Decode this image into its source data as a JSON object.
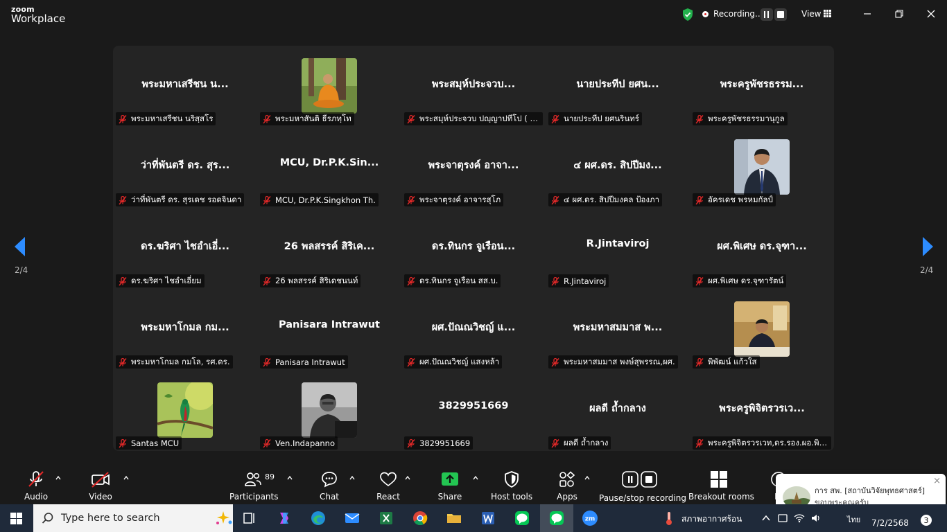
{
  "window": {
    "brand_top": "zoom",
    "brand_bottom": "Workplace",
    "recording_label": "Recording...",
    "view_label": "View"
  },
  "colors": {
    "accent_blue": "#2d8cff",
    "muted_red": "#e02828",
    "verified_green": "#23b14d",
    "share_green": "#23c552"
  },
  "gallery": {
    "page_left": "2/4",
    "page_right": "2/4",
    "tiles": [
      {
        "big": "พระมหาเสรีชน น...",
        "label": "พระมหาเสรีชน นริสฺสโร",
        "photo": ""
      },
      {
        "big": "",
        "label": "พระมหาสันติ ธีรภทฺโท",
        "photo": "monk-photo"
      },
      {
        "big": "พระสมุห์ประจวบ...",
        "label": "พระสมุห์ประจวบ  ปญฺญาปทีโป ( อย่...",
        "photo": ""
      },
      {
        "big": "นายประทีป  ยศน...",
        "label": "นายประทีป  ยศนรินทร์",
        "photo": ""
      },
      {
        "big": "พระครูพัชรธรรม...",
        "label": "พระครูพัชรธรรมานุกูล",
        "photo": ""
      },
      {
        "big": "ว่าที่พันตรี ดร. สุร...",
        "label": "ว่าที่พันตรี ดร. สุรเดช รอดจินดา",
        "photo": ""
      },
      {
        "big": "MCU,  Dr.P.K.Sin...",
        "label": "MCU, Dr.P.K.Singkhon Th.",
        "photo": ""
      },
      {
        "big": "พระจาตุรงค์ อาจา...",
        "label": "พระจาตุรงค์ อาจารสุโภ",
        "photo": ""
      },
      {
        "big": "๔ ผศ.ดร. สิปปีมง...",
        "label": "๔ ผศ.ดร. สิปปีมงคล ป้องภา",
        "photo": ""
      },
      {
        "big": "",
        "label": "อัครเดช พรหมกัลป์",
        "photo": "suit-photo"
      },
      {
        "big": "ดร.ฆริศา ไชอำเอี่...",
        "label": "ดร.ฆริศา  ไชอำเอี่ยม",
        "photo": ""
      },
      {
        "big": "26 พลสรรค์ สิริเค...",
        "label": "26 พลสรรค์ สิริเดชนนท์",
        "photo": ""
      },
      {
        "big": "ดร.ทินกร จูเรือน...",
        "label": "ดร.ทินกร จูเรือน สส.บ.",
        "photo": ""
      },
      {
        "big": "R.Jintaviroj",
        "label": "R.Jintaviroj",
        "photo": ""
      },
      {
        "big": "ผศ.พิเศษ ดร.จุฑา...",
        "label": "ผศ.พิเศษ ดร.จุฑารัตน์",
        "photo": ""
      },
      {
        "big": "พระมหาโกมล กม...",
        "label": "พระมหาโกมล กมโล, รศ.ดร.",
        "photo": ""
      },
      {
        "big": "Panisara Intrawut",
        "label": "Panisara Intrawut",
        "photo": ""
      },
      {
        "big": "ผศ.ปัณณวิชญ์  แ...",
        "label": "ผศ.ปัณณวิชญ์  แสงหล้า",
        "photo": ""
      },
      {
        "big": "พระมหาสมมาส พ...",
        "label": "พระมหาสมมาส พงษ์สุพรรณ,ผศ.",
        "photo": ""
      },
      {
        "big": "",
        "label": "พิพัฒน์  แก้วใส",
        "photo": "desk-photo"
      },
      {
        "big": "",
        "label": "Santas MCU",
        "photo": "bird-photo"
      },
      {
        "big": "",
        "label": "Ven.Indapanno",
        "photo": "man-photo"
      },
      {
        "big": "3829951669",
        "label": "3829951669",
        "photo": ""
      },
      {
        "big": "ผลดี ถ้ำกลาง",
        "label": "ผลดี ถ้ำกลาง",
        "photo": ""
      },
      {
        "big": "พระครูพิจิตรวรเว...",
        "label": "พระครูพิจิตรวรเวท,ดร.รอง.ผอ.พิจิต...",
        "photo": ""
      }
    ]
  },
  "toolbar": {
    "audio": "Audio",
    "video": "Video",
    "participants": "Participants",
    "participants_count": "89",
    "chat": "Chat",
    "react": "React",
    "share": "Share",
    "host_tools": "Host tools",
    "apps": "Apps",
    "pause_stop": "Pause/stop recording",
    "breakout": "Breakout rooms",
    "more_partial": "M"
  },
  "notification": {
    "title": "การ สพ. [สถาบันวิจัยพุทธศาสตร์]",
    "message": "ขอบพระคุณครับ",
    "close": "×"
  },
  "taskbar": {
    "search_placeholder": "Type here to search",
    "weather": "สภาพอากาศร้อน",
    "lang": "ไทย",
    "date": "7/2/2568",
    "notif_count": "3"
  }
}
